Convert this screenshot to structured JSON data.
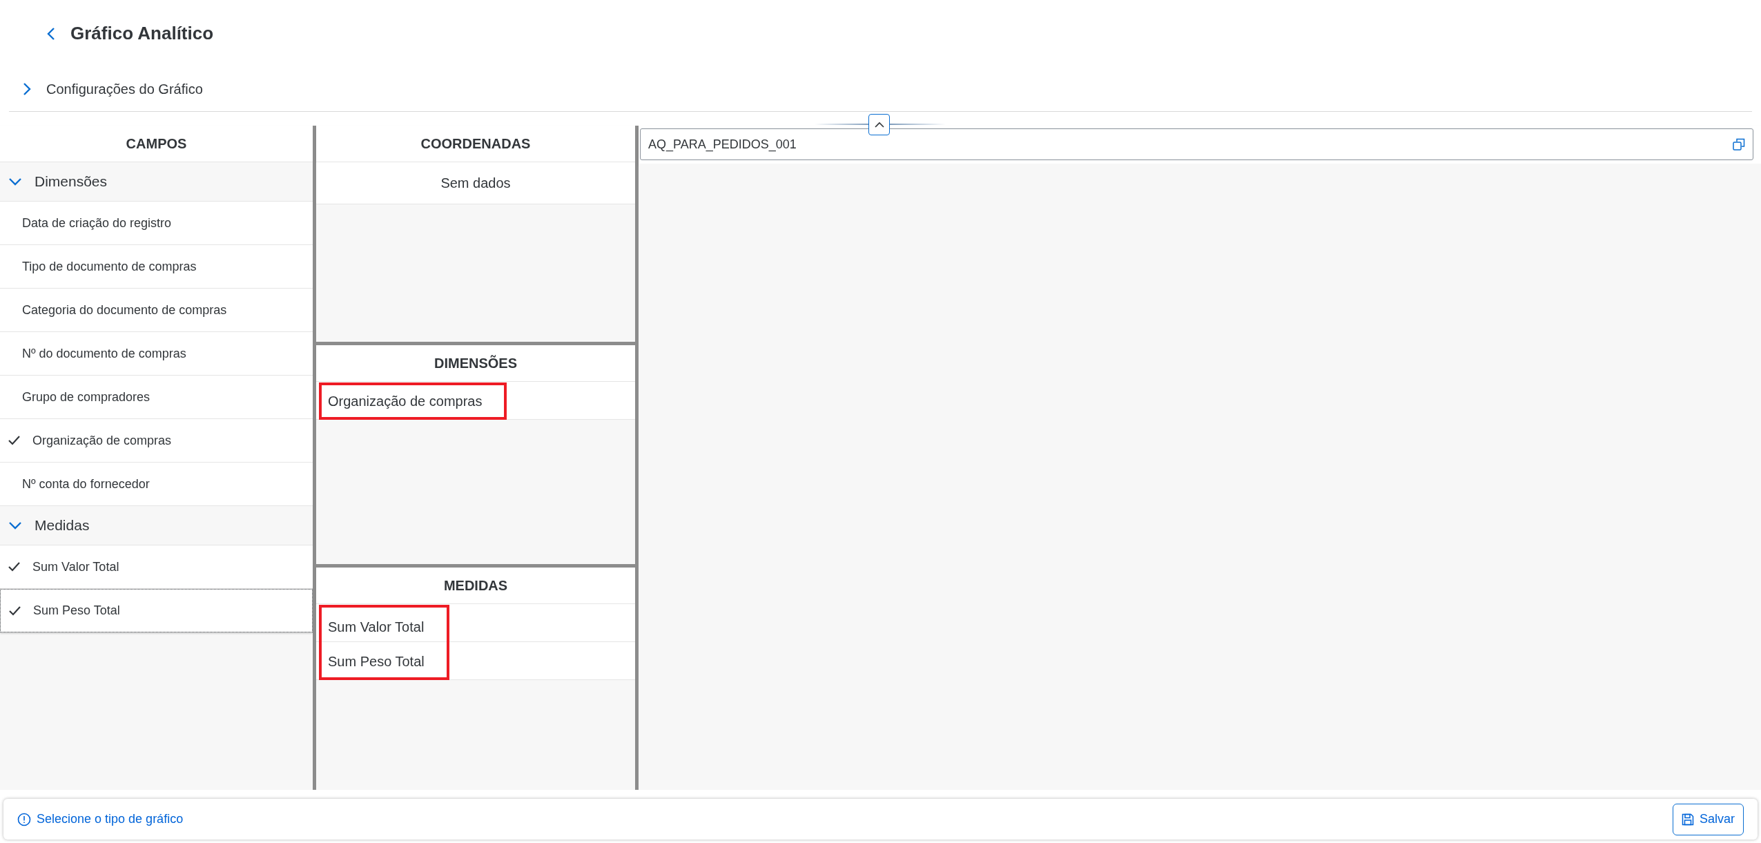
{
  "page": {
    "title": "Gráfico Analítico"
  },
  "settings_section": {
    "label": "Configurações do Gráfico",
    "expanded": false
  },
  "fields_panel": {
    "title": "CAMPOS",
    "groups": [
      {
        "label": "Dimensões",
        "expanded": true,
        "items": [
          {
            "label": "Data de criação do registro",
            "checked": false,
            "selected": false
          },
          {
            "label": "Tipo de documento de compras",
            "checked": false,
            "selected": false
          },
          {
            "label": "Categoria do documento de compras",
            "checked": false,
            "selected": false
          },
          {
            "label": "Nº do documento de compras",
            "checked": false,
            "selected": false
          },
          {
            "label": "Grupo de compradores",
            "checked": false,
            "selected": false
          },
          {
            "label": "Organização de compras",
            "checked": true,
            "selected": false
          },
          {
            "label": "Nº conta do fornecedor",
            "checked": false,
            "selected": false
          }
        ]
      },
      {
        "label": "Medidas",
        "expanded": true,
        "items": [
          {
            "label": "Sum Valor Total",
            "checked": true,
            "selected": false
          },
          {
            "label": "Sum Peso Total",
            "checked": true,
            "selected": true
          }
        ]
      }
    ]
  },
  "coordinates_panel": {
    "title": "COORDENADAS",
    "empty_text": "Sem dados"
  },
  "dimensions_panel": {
    "title": "DIMENSÕES",
    "highlighted": true,
    "items": [
      "Organização de compras"
    ]
  },
  "measures_panel": {
    "title": "MEDIDAS",
    "highlighted": true,
    "items": [
      "Sum Valor Total",
      "Sum Peso Total"
    ]
  },
  "chart_area": {
    "name_field": "AQ_PARA_PEDIDOS_001"
  },
  "footer": {
    "message": "Selecione o tipo de gráfico",
    "save_button": "Salvar"
  }
}
